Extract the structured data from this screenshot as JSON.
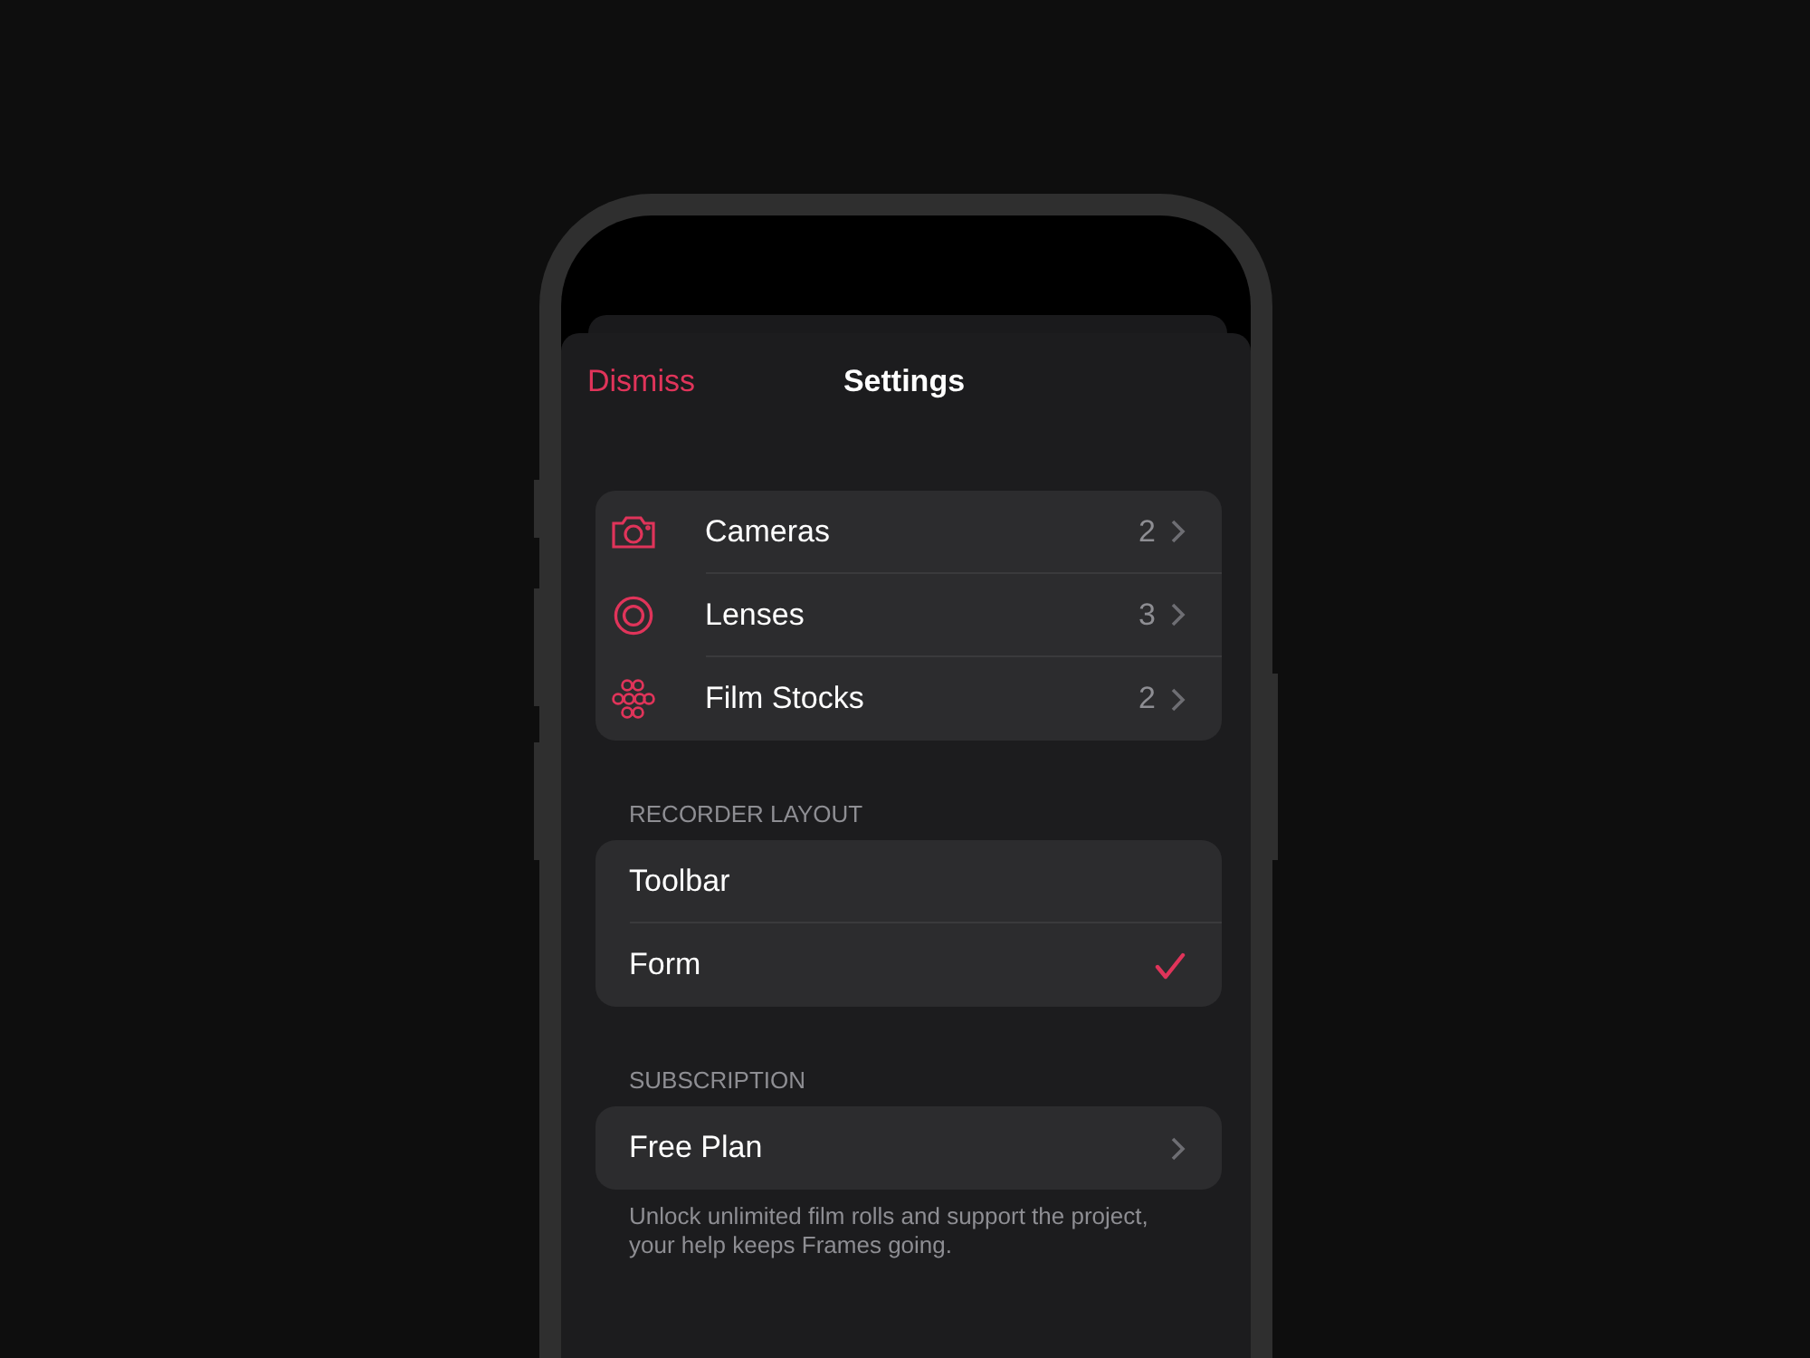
{
  "nav": {
    "dismiss": "Dismiss",
    "title": "Settings"
  },
  "library": [
    {
      "label": "Cameras",
      "count": "2"
    },
    {
      "label": "Lenses",
      "count": "3"
    },
    {
      "label": "Film Stocks",
      "count": "2"
    }
  ],
  "recorder_layout": {
    "header": "RECORDER LAYOUT",
    "options": [
      {
        "label": "Toolbar",
        "selected": false
      },
      {
        "label": "Form",
        "selected": true
      }
    ]
  },
  "subscription": {
    "header": "SUBSCRIPTION",
    "plan": "Free Plan",
    "footer": "Unlock unlimited film rolls and support the project, your help keeps Frames going."
  }
}
